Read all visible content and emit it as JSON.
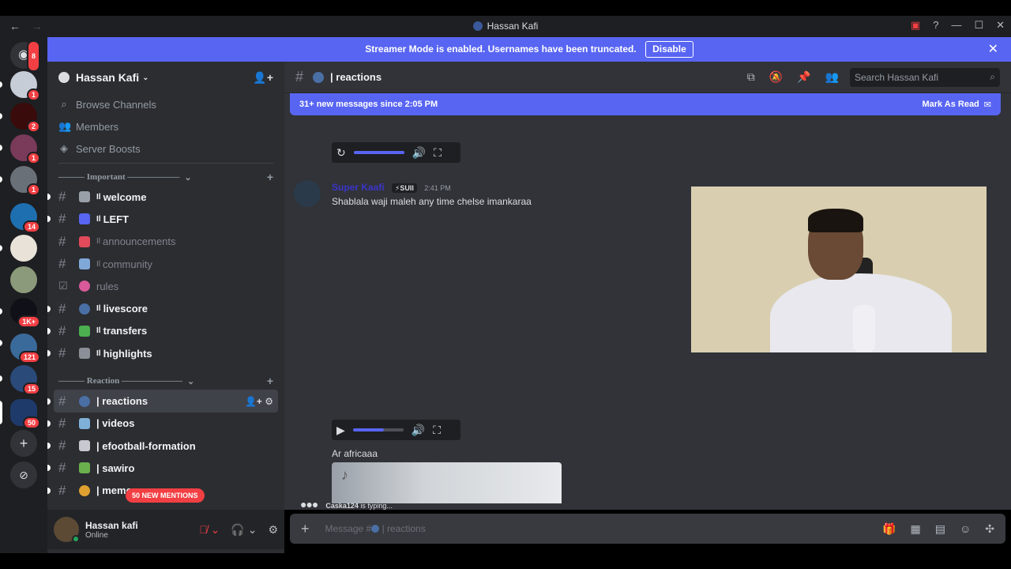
{
  "window": {
    "title": "Hassan Kafi",
    "back": "←",
    "forward": "→"
  },
  "banner": {
    "text": "Streamer Mode is enabled. Usernames have been truncated.",
    "button": "Disable",
    "close": "✕"
  },
  "servers": [
    {
      "badge": "8"
    },
    {
      "badge": "1"
    },
    {
      "badge": "2"
    },
    {
      "badge": "1"
    },
    {
      "badge": "1"
    },
    {
      "badge": "14"
    },
    {
      "badge": ""
    },
    {
      "badge": ""
    },
    {
      "badge": "1K+"
    },
    {
      "badge": "121"
    },
    {
      "badge": "15"
    },
    {
      "badge": "50"
    }
  ],
  "sidebar": {
    "guild_name": "Hassan Kafi",
    "nav": [
      {
        "label": "Browse Channels"
      },
      {
        "label": "Members"
      },
      {
        "label": "Server Boosts"
      }
    ],
    "categories": [
      {
        "label": "——— Important ——————"
      },
      {
        "label": "——— Reaction ———————"
      }
    ],
    "channels_important": [
      {
        "label": "welcome",
        "prefix": "Il"
      },
      {
        "label": "LEFT",
        "prefix": "Il"
      },
      {
        "label": "announcements",
        "prefix": "Il"
      },
      {
        "label": "community",
        "prefix": "Il"
      },
      {
        "label": "rules",
        "prefix": ""
      },
      {
        "label": "livescore",
        "prefix": "Il"
      },
      {
        "label": "transfers",
        "prefix": "Il"
      },
      {
        "label": "highlights",
        "prefix": "Il"
      }
    ],
    "channels_reaction": [
      {
        "label": "| reactions"
      },
      {
        "label": "| videos"
      },
      {
        "label": "| efootball-formation"
      },
      {
        "label": "| sawiro"
      },
      {
        "label": "| memes"
      }
    ],
    "mentions": "50 NEW MENTIONS"
  },
  "user": {
    "name": "Hassan kafi",
    "status": "Online"
  },
  "channel": {
    "name": "| reactions",
    "search_placeholder": "Search Hassan Kafi"
  },
  "new_messages": {
    "text": "31+ new messages since 2:05 PM",
    "action": "Mark As Read"
  },
  "message": {
    "author": "Super Kaafi",
    "tag": "⚡SUII",
    "time": "2:41 PM",
    "text": "Shablala waji maleh any time chelse imankaraa"
  },
  "caption": "Ar africaaa",
  "typing": {
    "dots": "●●●",
    "user": "Caska124",
    "suffix": " is typing..."
  },
  "composer": {
    "placeholder_prefix": "Message #",
    "placeholder_channel": "| reactions"
  }
}
